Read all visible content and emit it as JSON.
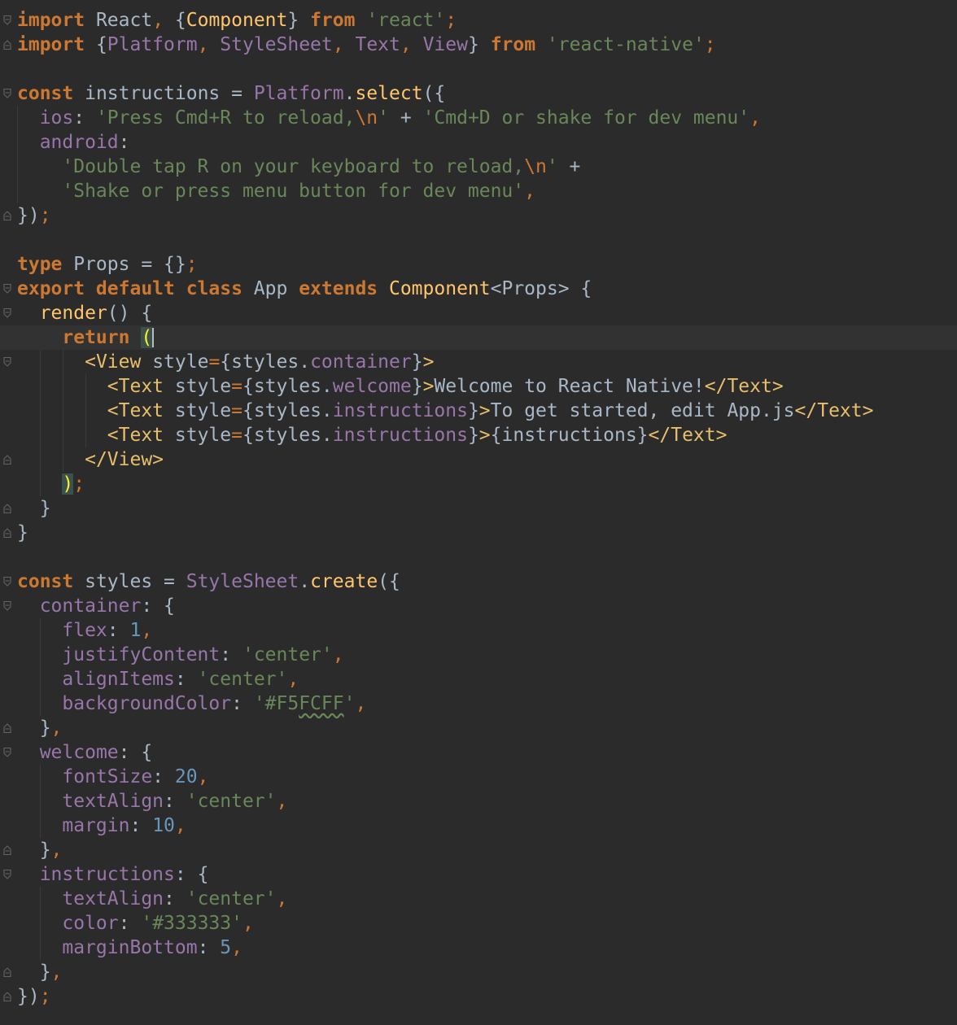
{
  "editor": {
    "language": "javascript",
    "theme_colors": {
      "background": "#2b2b2b",
      "current_line": "#323232",
      "keyword": "#cc7832",
      "identifier": "#a9b7c6",
      "string": "#6a8759",
      "property": "#9876aa",
      "number": "#6897bb",
      "function": "#ffc66d",
      "jsx_tag": "#e8bf6a"
    },
    "current_line_index": 13,
    "lines": [
      {
        "fold": "open",
        "tokens": [
          [
            "kw",
            "import"
          ],
          [
            "id",
            " React"
          ],
          [
            "punc",
            ","
          ],
          [
            "id",
            " {"
          ],
          [
            "fn",
            "Component"
          ],
          [
            "id",
            "} "
          ],
          [
            "kw",
            "from"
          ],
          [
            "str",
            " 'react'"
          ],
          [
            "punc",
            ";"
          ]
        ]
      },
      {
        "fold": "close",
        "tokens": [
          [
            "kw",
            "import"
          ],
          [
            "id",
            " {"
          ],
          [
            "prop",
            "Platform"
          ],
          [
            "punc",
            ","
          ],
          [
            "prop",
            " StyleSheet"
          ],
          [
            "punc",
            ","
          ],
          [
            "prop",
            " Text"
          ],
          [
            "punc",
            ","
          ],
          [
            "prop",
            " View"
          ],
          [
            "id",
            "} "
          ],
          [
            "kw",
            "from"
          ],
          [
            "str",
            " 'react-native'"
          ],
          [
            "punc",
            ";"
          ]
        ]
      },
      {
        "fold": "",
        "tokens": []
      },
      {
        "fold": "open",
        "tokens": [
          [
            "kw",
            "const"
          ],
          [
            "id",
            " instructions = "
          ],
          [
            "prop",
            "Platform"
          ],
          [
            "id",
            "."
          ],
          [
            "fn",
            "select"
          ],
          [
            "id",
            "({"
          ]
        ]
      },
      {
        "fold": "",
        "tokens": [
          [
            "id",
            "  "
          ],
          [
            "prop",
            "ios"
          ],
          [
            "id",
            ": "
          ],
          [
            "str",
            "'Press Cmd+R to reload,"
          ],
          [
            "esc",
            "\\n"
          ],
          [
            "str",
            "'"
          ],
          [
            "id",
            " + "
          ],
          [
            "str",
            "'Cmd+D or shake for dev menu'"
          ],
          [
            "punc",
            ","
          ]
        ]
      },
      {
        "fold": "",
        "tokens": [
          [
            "id",
            "  "
          ],
          [
            "prop",
            "android"
          ],
          [
            "id",
            ":"
          ]
        ]
      },
      {
        "fold": "",
        "tokens": [
          [
            "id",
            "    "
          ],
          [
            "str",
            "'Double tap R on your keyboard to reload,"
          ],
          [
            "esc",
            "\\n"
          ],
          [
            "str",
            "'"
          ],
          [
            "id",
            " +"
          ]
        ]
      },
      {
        "fold": "",
        "tokens": [
          [
            "id",
            "    "
          ],
          [
            "str",
            "'Shake or press menu button for dev menu'"
          ],
          [
            "punc",
            ","
          ]
        ]
      },
      {
        "fold": "close",
        "tokens": [
          [
            "id",
            "})"
          ],
          [
            "punc",
            ";"
          ]
        ]
      },
      {
        "fold": "",
        "tokens": []
      },
      {
        "fold": "",
        "tokens": [
          [
            "kw",
            "type"
          ],
          [
            "id",
            " Props = {}"
          ],
          [
            "punc",
            ";"
          ]
        ]
      },
      {
        "fold": "open",
        "tokens": [
          [
            "kw",
            "export default class"
          ],
          [
            "id",
            " App "
          ],
          [
            "kw",
            "extends"
          ],
          [
            "typ",
            " Component"
          ],
          [
            "id",
            "<Props> {"
          ]
        ]
      },
      {
        "fold": "open",
        "tokens": [
          [
            "id",
            "  "
          ],
          [
            "fn",
            "render"
          ],
          [
            "id",
            "() {"
          ]
        ]
      },
      {
        "fold": "",
        "tokens": [
          [
            "id",
            "    "
          ],
          [
            "kw",
            "return"
          ],
          [
            "id",
            " "
          ],
          [
            "brace",
            "("
          ],
          [
            "caret",
            ""
          ]
        ]
      },
      {
        "fold": "open",
        "tokens": [
          [
            "id",
            "      "
          ],
          [
            "tag",
            "<View"
          ],
          [
            "id",
            " style"
          ],
          [
            "punc",
            "="
          ],
          [
            "id",
            "{styles."
          ],
          [
            "prop",
            "container"
          ],
          [
            "id",
            "}"
          ],
          [
            "tag",
            ">"
          ]
        ]
      },
      {
        "fold": "",
        "tokens": [
          [
            "id",
            "        "
          ],
          [
            "tag",
            "<Text"
          ],
          [
            "id",
            " style"
          ],
          [
            "punc",
            "="
          ],
          [
            "id",
            "{styles."
          ],
          [
            "prop",
            "welcome"
          ],
          [
            "id",
            "}"
          ],
          [
            "tag",
            ">"
          ],
          [
            "id",
            "Welcome to React Native!"
          ],
          [
            "tag",
            "</Text>"
          ]
        ]
      },
      {
        "fold": "",
        "tokens": [
          [
            "id",
            "        "
          ],
          [
            "tag",
            "<Text"
          ],
          [
            "id",
            " style"
          ],
          [
            "punc",
            "="
          ],
          [
            "id",
            "{styles."
          ],
          [
            "prop",
            "instructions"
          ],
          [
            "id",
            "}"
          ],
          [
            "tag",
            ">"
          ],
          [
            "id",
            "To get started, edit App.js"
          ],
          [
            "tag",
            "</Text>"
          ]
        ]
      },
      {
        "fold": "",
        "tokens": [
          [
            "id",
            "        "
          ],
          [
            "tag",
            "<Text"
          ],
          [
            "id",
            " style"
          ],
          [
            "punc",
            "="
          ],
          [
            "id",
            "{styles."
          ],
          [
            "prop",
            "instructions"
          ],
          [
            "id",
            "}"
          ],
          [
            "tag",
            ">"
          ],
          [
            "id",
            "{instructions}"
          ],
          [
            "tag",
            "</Text>"
          ]
        ]
      },
      {
        "fold": "close",
        "tokens": [
          [
            "id",
            "      "
          ],
          [
            "tag",
            "</View>"
          ]
        ]
      },
      {
        "fold": "",
        "tokens": [
          [
            "id",
            "    "
          ],
          [
            "brace",
            ")"
          ],
          [
            "punc",
            ";"
          ]
        ]
      },
      {
        "fold": "close",
        "tokens": [
          [
            "id",
            "  }"
          ]
        ]
      },
      {
        "fold": "close",
        "tokens": [
          [
            "id",
            "}"
          ]
        ]
      },
      {
        "fold": "",
        "tokens": []
      },
      {
        "fold": "open",
        "tokens": [
          [
            "kw",
            "const"
          ],
          [
            "id",
            " styles = "
          ],
          [
            "prop",
            "StyleSheet"
          ],
          [
            "id",
            "."
          ],
          [
            "fn",
            "create"
          ],
          [
            "id",
            "({"
          ]
        ]
      },
      {
        "fold": "open",
        "tokens": [
          [
            "id",
            "  "
          ],
          [
            "prop",
            "container"
          ],
          [
            "id",
            ": {"
          ]
        ]
      },
      {
        "fold": "",
        "tokens": [
          [
            "id",
            "    "
          ],
          [
            "prop",
            "flex"
          ],
          [
            "id",
            ": "
          ],
          [
            "num",
            "1"
          ],
          [
            "punc",
            ","
          ]
        ]
      },
      {
        "fold": "",
        "tokens": [
          [
            "id",
            "    "
          ],
          [
            "prop",
            "justifyContent"
          ],
          [
            "id",
            ": "
          ],
          [
            "str",
            "'center'"
          ],
          [
            "punc",
            ","
          ]
        ]
      },
      {
        "fold": "",
        "tokens": [
          [
            "id",
            "    "
          ],
          [
            "prop",
            "alignItems"
          ],
          [
            "id",
            ": "
          ],
          [
            "str",
            "'center'"
          ],
          [
            "punc",
            ","
          ]
        ]
      },
      {
        "fold": "",
        "tokens": [
          [
            "id",
            "    "
          ],
          [
            "prop",
            "backgroundColor"
          ],
          [
            "id",
            ": "
          ],
          [
            "str",
            "'#F5"
          ],
          [
            "squig",
            "FCFF"
          ],
          [
            "str",
            "'"
          ],
          [
            "punc",
            ","
          ]
        ]
      },
      {
        "fold": "close",
        "tokens": [
          [
            "id",
            "  }"
          ],
          [
            "punc",
            ","
          ]
        ]
      },
      {
        "fold": "open",
        "tokens": [
          [
            "id",
            "  "
          ],
          [
            "prop",
            "welcome"
          ],
          [
            "id",
            ": {"
          ]
        ]
      },
      {
        "fold": "",
        "tokens": [
          [
            "id",
            "    "
          ],
          [
            "prop",
            "fontSize"
          ],
          [
            "id",
            ": "
          ],
          [
            "num",
            "20"
          ],
          [
            "punc",
            ","
          ]
        ]
      },
      {
        "fold": "",
        "tokens": [
          [
            "id",
            "    "
          ],
          [
            "prop",
            "textAlign"
          ],
          [
            "id",
            ": "
          ],
          [
            "str",
            "'center'"
          ],
          [
            "punc",
            ","
          ]
        ]
      },
      {
        "fold": "",
        "tokens": [
          [
            "id",
            "    "
          ],
          [
            "prop",
            "margin"
          ],
          [
            "id",
            ": "
          ],
          [
            "num",
            "10"
          ],
          [
            "punc",
            ","
          ]
        ]
      },
      {
        "fold": "close",
        "tokens": [
          [
            "id",
            "  }"
          ],
          [
            "punc",
            ","
          ]
        ]
      },
      {
        "fold": "open",
        "tokens": [
          [
            "id",
            "  "
          ],
          [
            "prop",
            "instructions"
          ],
          [
            "id",
            ": {"
          ]
        ]
      },
      {
        "fold": "",
        "tokens": [
          [
            "id",
            "    "
          ],
          [
            "prop",
            "textAlign"
          ],
          [
            "id",
            ": "
          ],
          [
            "str",
            "'center'"
          ],
          [
            "punc",
            ","
          ]
        ]
      },
      {
        "fold": "",
        "tokens": [
          [
            "id",
            "    "
          ],
          [
            "prop",
            "color"
          ],
          [
            "id",
            ": "
          ],
          [
            "str",
            "'#333333'"
          ],
          [
            "punc",
            ","
          ]
        ]
      },
      {
        "fold": "",
        "tokens": [
          [
            "id",
            "    "
          ],
          [
            "prop",
            "marginBottom"
          ],
          [
            "id",
            ": "
          ],
          [
            "num",
            "5"
          ],
          [
            "punc",
            ","
          ]
        ]
      },
      {
        "fold": "close",
        "tokens": [
          [
            "id",
            "  }"
          ],
          [
            "punc",
            ","
          ]
        ]
      },
      {
        "fold": "close",
        "tokens": [
          [
            "id",
            "})"
          ],
          [
            "punc",
            ";"
          ]
        ]
      }
    ]
  }
}
